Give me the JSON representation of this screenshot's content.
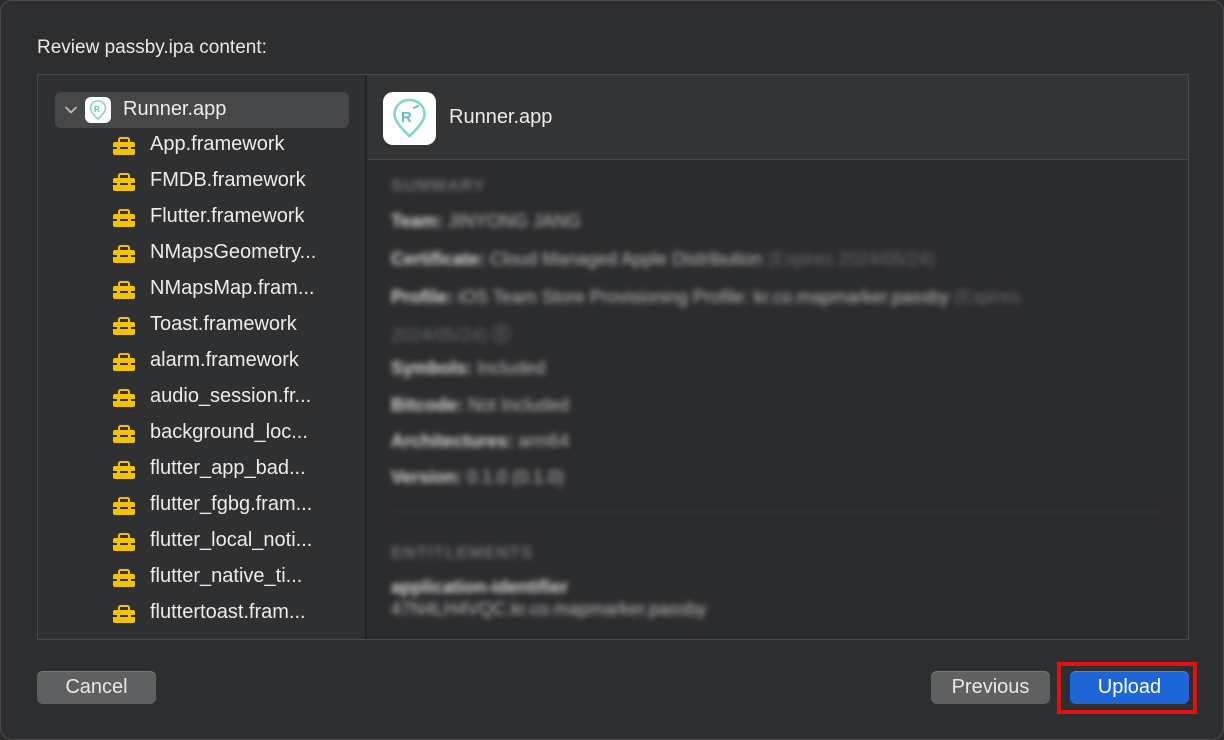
{
  "dialog": {
    "title": "Review passby.ipa content:"
  },
  "tree": {
    "root": {
      "label": "Runner.app",
      "expanded": true
    },
    "items": [
      {
        "label": "App.framework"
      },
      {
        "label": "FMDB.framework"
      },
      {
        "label": "Flutter.framework"
      },
      {
        "label": "NMapsGeometry..."
      },
      {
        "label": "NMapsMap.fram..."
      },
      {
        "label": "Toast.framework"
      },
      {
        "label": "alarm.framework"
      },
      {
        "label": "audio_session.fr..."
      },
      {
        "label": "background_loc..."
      },
      {
        "label": "flutter_app_bad..."
      },
      {
        "label": "flutter_fgbg.fram..."
      },
      {
        "label": "flutter_local_noti..."
      },
      {
        "label": "flutter_native_ti..."
      },
      {
        "label": "fluttertoast.fram..."
      }
    ]
  },
  "detail": {
    "title": "Runner.app",
    "summary_heading": "SUMMARY",
    "team_label": "Team:",
    "team_value": "JINYONG JANG",
    "certificate_label": "Certificate:",
    "certificate_value": "Cloud Managed Apple Distribution",
    "certificate_expiry": "(Expires 2024/05/24)",
    "profile_label": "Profile:",
    "profile_value": "iOS Team Store Provisioning Profile: kr.co.mapmarker.passby",
    "profile_expiry_a": "(Expires",
    "profile_expiry_b": "2024/05/24)",
    "symbols_label": "Symbols:",
    "symbols_value": "Included",
    "bitcode_label": "Bitcode:",
    "bitcode_value": "Not Included",
    "architectures_label": "Architectures:",
    "architectures_value": "arm64",
    "version_label": "Version:",
    "version_value": "0.1.0 (0.1.0)",
    "entitlements_heading": "ENTITLEMENTS",
    "entitlement_key": "application-identifier",
    "entitlement_value": "47N4LH4VQC.kr.co.mapmarker.passby"
  },
  "buttons": {
    "cancel": "Cancel",
    "previous": "Previous",
    "upload": "Upload"
  },
  "colors": {
    "primary_button": "#1e66d8",
    "highlight": "#e00f12",
    "framework_icon": "#f5c400"
  }
}
